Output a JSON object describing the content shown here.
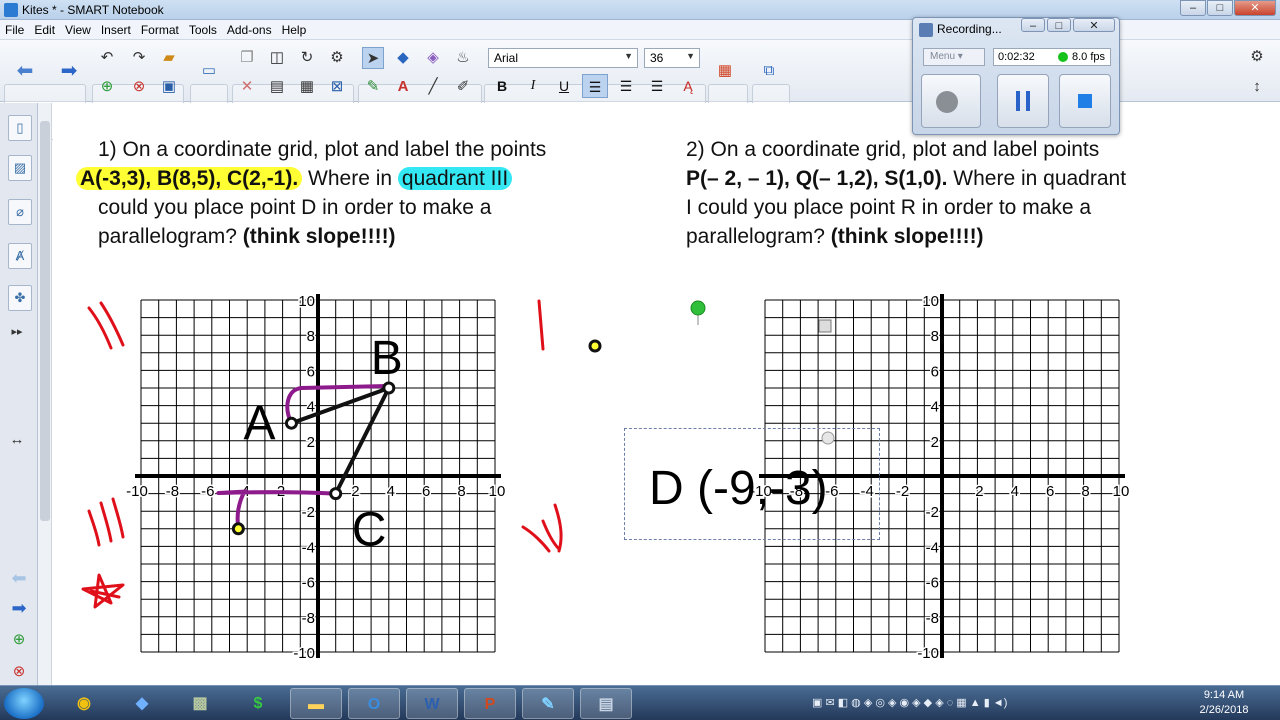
{
  "window": {
    "title": "Kites * - SMART Notebook",
    "min": "–",
    "max": "□",
    "close": "✕"
  },
  "menu": [
    "File",
    "Edit",
    "View",
    "Insert",
    "Format",
    "Tools",
    "Add-ons",
    "Help"
  ],
  "toolbar": {
    "font": "Arial",
    "size": "36",
    "bold": "B",
    "italic": "I",
    "underline": "U"
  },
  "recorder": {
    "title": "Recording...",
    "menu": "Menu",
    "time": "0:02:32",
    "fps": "8.0 fps"
  },
  "problem1": {
    "line1": "1) On a coordinate grid, plot and label the points",
    "points": "A(-3,3), B(8,5), C(2,-1).",
    "where": " Where in ",
    "quadrant": "quadrant III",
    "line3": "could you place point D in order to make a",
    "line4": "parallelogram? ",
    "hint": "(think slope!!!!)"
  },
  "problem2": {
    "line1": "2) On a coordinate grid, plot and label points",
    "points": "P(– 2, – 1), Q(– 1,2), S(1,0).",
    "where": " Where in quadrant",
    "line3": "I could you place point R in order to make a",
    "line4": "parallelogram? ",
    "hint": "(think slope!!!!)"
  },
  "grid": {
    "xticks": [
      "-10",
      "-8",
      "-6",
      "-4",
      "-2",
      "2",
      "4",
      "6",
      "8",
      "10"
    ],
    "yticks": [
      "10",
      "8",
      "6",
      "4",
      "2",
      "-2",
      "-4",
      "-6",
      "-8",
      "-10"
    ]
  },
  "labels": {
    "A": "A",
    "B": "B",
    "C": "C",
    "D": "D (-9,-3)"
  },
  "taskbar": {
    "time": "9:14 AM",
    "date": "2/26/2018"
  },
  "colors": {
    "highlight_yellow": "#ffff33",
    "highlight_cyan": "#33e8f2",
    "ink_purple": "#8e1b8c",
    "ink_red": "#e0101a"
  }
}
